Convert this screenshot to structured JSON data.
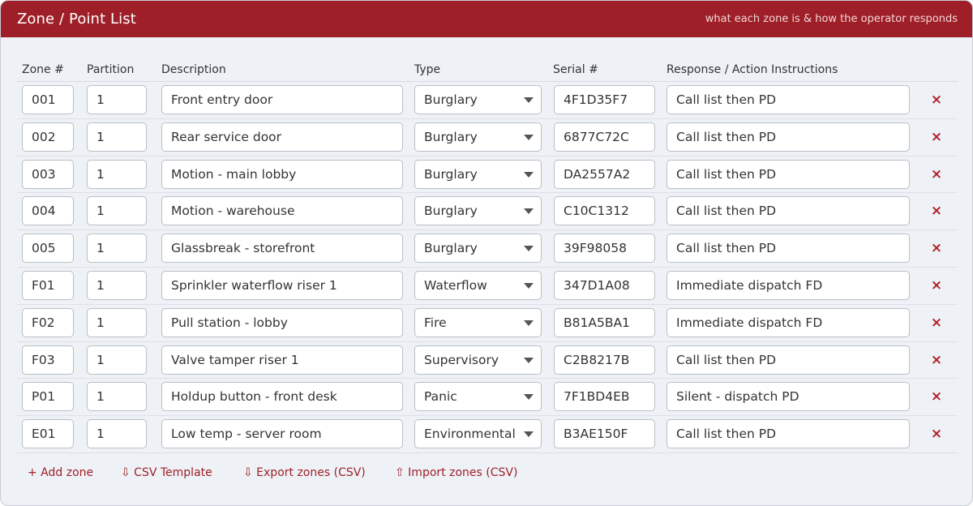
{
  "header": {
    "title": "Zone / Point List",
    "subtitle": "what each zone is & how the operator responds"
  },
  "columns": {
    "zone": "Zone #",
    "partition": "Partition",
    "description": "Description",
    "type": "Type",
    "serial": "Serial #",
    "response": "Response / Action Instructions"
  },
  "rows": [
    {
      "zone": "001",
      "partition": "1",
      "description": "Front entry door",
      "type": "Burglary",
      "serial": "4F1D35F7",
      "response": "Call list then PD"
    },
    {
      "zone": "002",
      "partition": "1",
      "description": "Rear service door",
      "type": "Burglary",
      "serial": "6877C72C",
      "response": "Call list then PD"
    },
    {
      "zone": "003",
      "partition": "1",
      "description": "Motion - main lobby",
      "type": "Burglary",
      "serial": "DA2557A2",
      "response": "Call list then PD"
    },
    {
      "zone": "004",
      "partition": "1",
      "description": "Motion - warehouse",
      "type": "Burglary",
      "serial": "C10C1312",
      "response": "Call list then PD"
    },
    {
      "zone": "005",
      "partition": "1",
      "description": "Glassbreak - storefront",
      "type": "Burglary",
      "serial": "39F98058",
      "response": "Call list then PD"
    },
    {
      "zone": "F01",
      "partition": "1",
      "description": "Sprinkler waterflow riser 1",
      "type": "Waterflow",
      "serial": "347D1A08",
      "response": "Immediate dispatch FD"
    },
    {
      "zone": "F02",
      "partition": "1",
      "description": "Pull station - lobby",
      "type": "Fire",
      "serial": "B81A5BA1",
      "response": "Immediate dispatch FD"
    },
    {
      "zone": "F03",
      "partition": "1",
      "description": "Valve tamper riser 1",
      "type": "Supervisory",
      "serial": "C2B8217B",
      "response": "Call list then PD"
    },
    {
      "zone": "P01",
      "partition": "1",
      "description": "Holdup button - front desk",
      "type": "Panic",
      "serial": "7F1BD4EB",
      "response": "Silent - dispatch PD"
    },
    {
      "zone": "E01",
      "partition": "1",
      "description": "Low temp - server room",
      "type": "Environmental",
      "serial": "B3AE150F",
      "response": "Call list then PD"
    }
  ],
  "delete_symbol": "×",
  "actions": {
    "add_zone": "+ Add zone",
    "csv_template": "⇩ CSV Template",
    "export_csv": "⇩ Export zones (CSV)",
    "import_csv": "⇧ Import zones (CSV)"
  },
  "colors": {
    "brand": "#9e1f27",
    "panel_bg": "#eef2f7",
    "delete": "#b3222b"
  }
}
